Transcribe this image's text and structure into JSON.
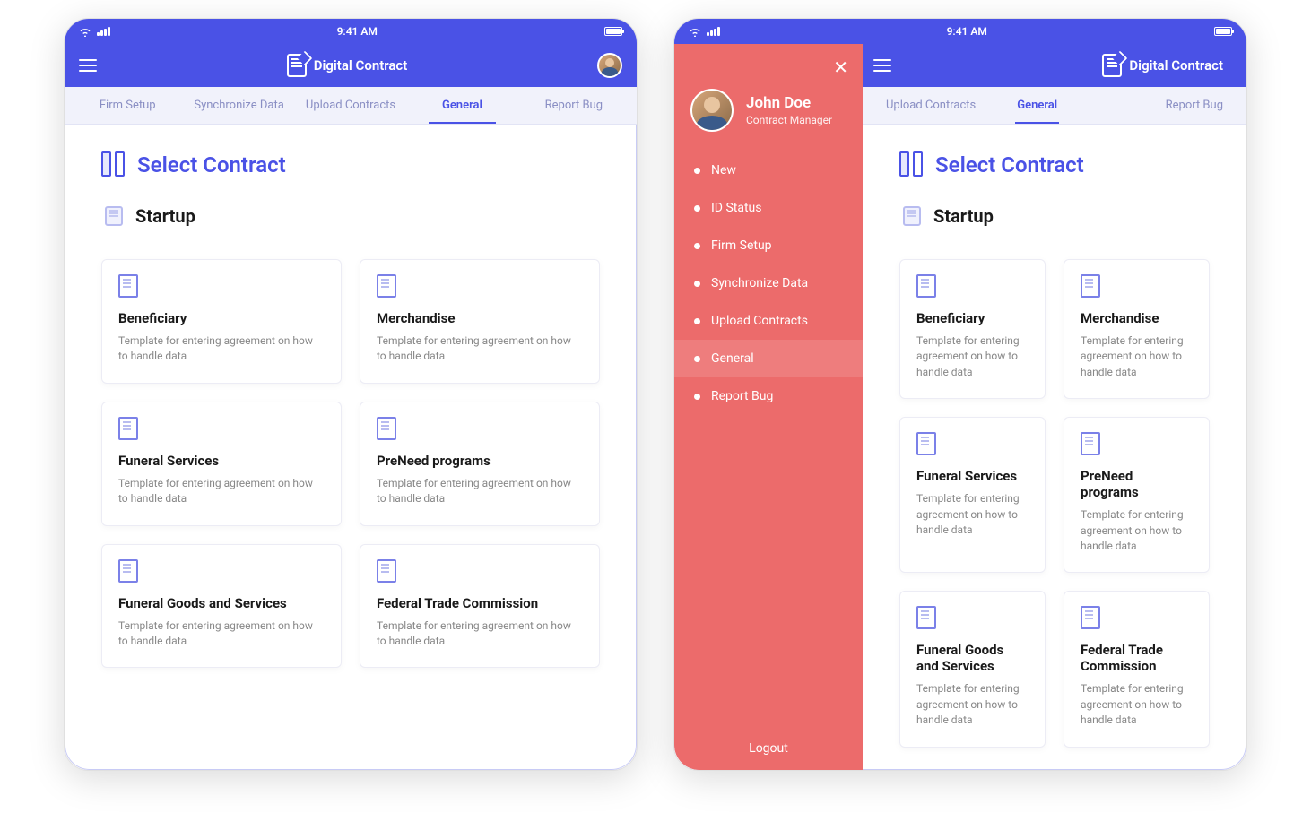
{
  "status": {
    "time": "9:41 AM"
  },
  "header": {
    "app_title": "Digital Contract"
  },
  "tabs_full": [
    {
      "label": "Firm Setup",
      "active": false
    },
    {
      "label": "Synchronize Data",
      "active": false
    },
    {
      "label": "Upload Contracts",
      "active": false
    },
    {
      "label": "General",
      "active": true
    },
    {
      "label": "Report Bug",
      "active": false
    }
  ],
  "tabs_partial": [
    {
      "label": "Upload Contracts",
      "active": false
    },
    {
      "label": "General",
      "active": true
    },
    {
      "label": "Report Bug",
      "active": false
    }
  ],
  "page": {
    "title": "Select Contract",
    "section": "Startup"
  },
  "card_desc": "Template for entering agreement on how to handle data",
  "cards": [
    {
      "title": "Beneficiary"
    },
    {
      "title": "Merchandise"
    },
    {
      "title": "Funeral Services"
    },
    {
      "title": "PreNeed programs"
    },
    {
      "title": "Funeral Goods and Services"
    },
    {
      "title": "Federal Trade Commission"
    }
  ],
  "sidebar": {
    "user_name": "John Doe",
    "user_role": "Contract Manager",
    "items": [
      {
        "label": "New",
        "active": false
      },
      {
        "label": "ID Status",
        "active": false
      },
      {
        "label": "Firm Setup",
        "active": false
      },
      {
        "label": "Synchronize Data",
        "active": false
      },
      {
        "label": "Upload Contracts",
        "active": false
      },
      {
        "label": "General",
        "active": true
      },
      {
        "label": "Report Bug",
        "active": false
      }
    ],
    "logout": "Logout"
  }
}
